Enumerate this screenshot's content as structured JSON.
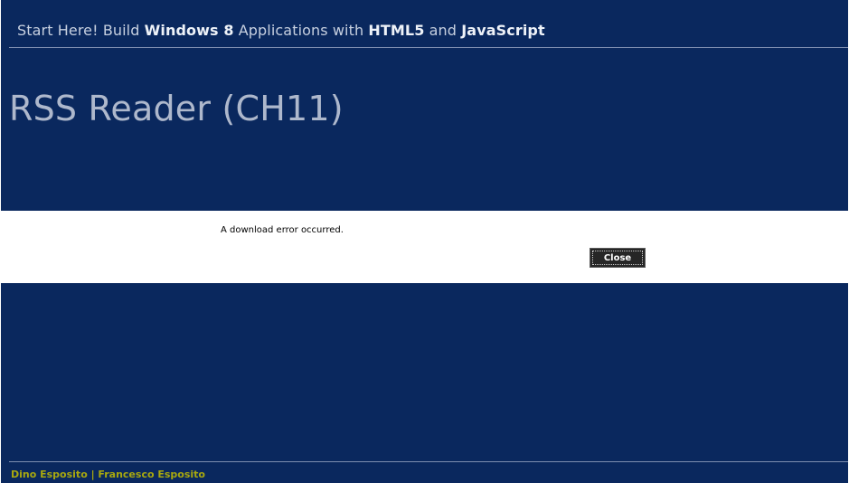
{
  "header": {
    "title_parts": {
      "part1": "Start Here! Build ",
      "bold1": "Windows 8",
      "part2": " Applications with ",
      "bold2": "HTML5",
      "part3": " and ",
      "bold3": "JavaScript"
    }
  },
  "page": {
    "title": "RSS Reader (CH11)"
  },
  "dialog": {
    "message": "A download error occurred.",
    "close_label": "Close"
  },
  "footer": {
    "authors": "Dino Esposito | Francesco Esposito"
  },
  "colors": {
    "background": "#0a285e",
    "dialog_background": "#ffffff",
    "footer_text": "#a8a80f",
    "button_background": "#262626"
  }
}
